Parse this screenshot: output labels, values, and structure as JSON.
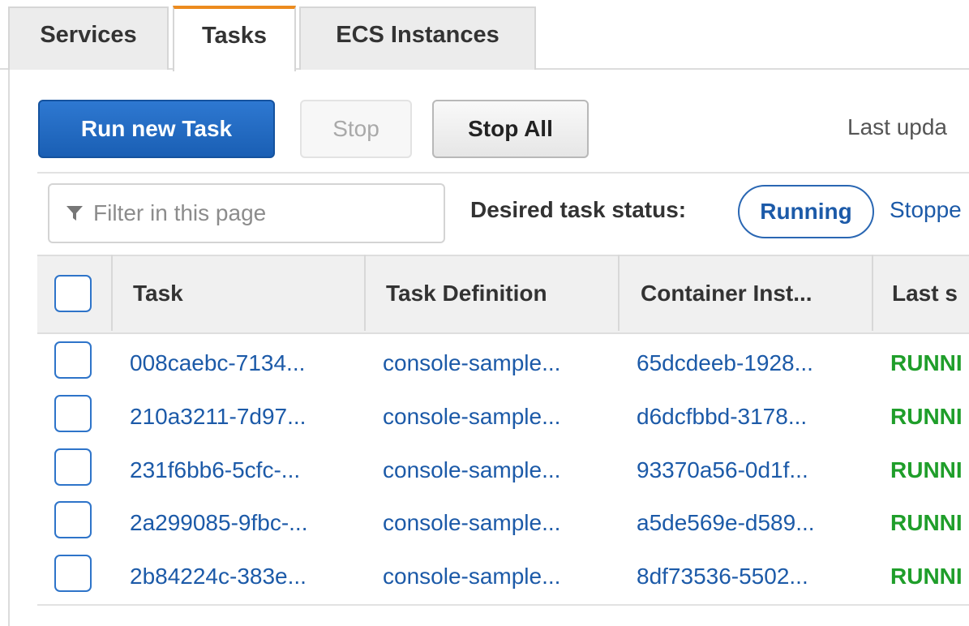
{
  "tabs": [
    {
      "label": "Services"
    },
    {
      "label": "Tasks"
    },
    {
      "label": "ECS Instances"
    }
  ],
  "toolbar": {
    "run_task": "Run new Task",
    "stop": "Stop",
    "stop_all": "Stop All",
    "last_updated": "Last upda"
  },
  "filter": {
    "placeholder": "Filter in this page",
    "desired_status_label": "Desired task status:",
    "status_running": "Running",
    "status_stopped": "Stoppe"
  },
  "table": {
    "columns": [
      "Task",
      "Task Definition",
      "Container Inst...",
      "Last s"
    ],
    "rows": [
      {
        "task": "008caebc-7134...",
        "definition": "console-sample...",
        "container": "65dcdeeb-1928...",
        "status": "RUNNI"
      },
      {
        "task": "210a3211-7d97...",
        "definition": "console-sample...",
        "container": "d6dcfbbd-3178...",
        "status": "RUNNI"
      },
      {
        "task": "231f6bb6-5cfc-...",
        "definition": "console-sample...",
        "container": "93370a56-0d1f...",
        "status": "RUNNI"
      },
      {
        "task": "2a299085-9fbc-...",
        "definition": "console-sample...",
        "container": "a5de569e-d589...",
        "status": "RUNNI"
      },
      {
        "task": "2b84224c-383e...",
        "definition": "console-sample...",
        "container": "8df73536-5502...",
        "status": "RUNNI"
      }
    ]
  },
  "colors": {
    "primary": "#1a5fb4",
    "link": "#1c5aa8",
    "running": "#1f9e2a",
    "active_tab_accent": "#ec8b1e"
  },
  "icons": {
    "filter": "filter-funnel-icon"
  }
}
